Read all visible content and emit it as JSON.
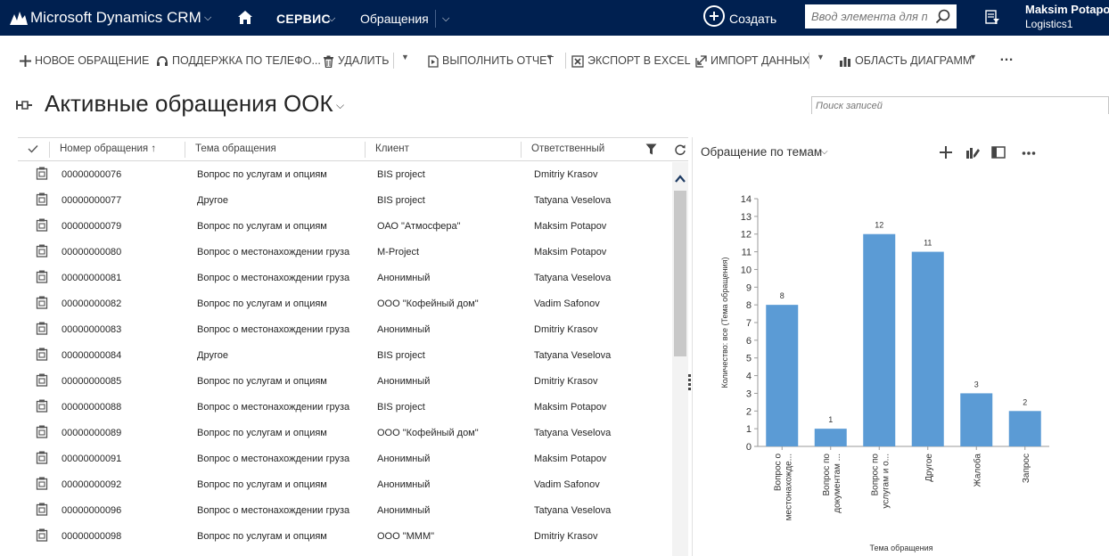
{
  "app": {
    "title": "Microsoft Dynamics CRM",
    "area": "СЕРВИС",
    "entity": "Обращения"
  },
  "create": {
    "label": "Создать"
  },
  "global_search": {
    "placeholder": "Ввод элемента для п"
  },
  "user": {
    "name": "Maksim Potapov",
    "org": "Logistics1"
  },
  "commands": [
    {
      "label": "НОВОЕ ОБРАЩЕНИЕ",
      "icon": "plus-icon"
    },
    {
      "label": "ПОДДЕРЖКА ПО ТЕЛЕФО...",
      "icon": "phone-support-icon"
    },
    {
      "label": "УДАЛИТЬ",
      "icon": "trash-icon"
    },
    {
      "label": "ВЫПОЛНИТЬ ОТЧЕТ",
      "icon": "report-icon"
    },
    {
      "label": "ЭКСПОРТ В EXCEL",
      "icon": "excel-icon"
    },
    {
      "label": "ИМПОРТ ДАННЫХ",
      "icon": "import-icon"
    },
    {
      "label": "ОБЛАСТЬ ДИАГРАММ",
      "icon": "chart-pane-icon"
    },
    {
      "label": "…",
      "icon": "more-icon"
    }
  ],
  "view": {
    "title": "Активные обращения ООК",
    "search_placeholder": "Поиск записей"
  },
  "grid": {
    "columns": [
      "Номер обращения",
      "Тема обращения",
      "Клиент",
      "Ответственный"
    ],
    "sort_indicator": "↑",
    "rows": [
      [
        "00000000076",
        "Вопрос по услугам и опциям",
        "BIS project",
        "Dmitriy Krasov"
      ],
      [
        "00000000077",
        "Другое",
        "BIS project",
        "Tatyana Veselova"
      ],
      [
        "00000000079",
        "Вопрос по услугам и опциям",
        "ОАО \"Атмосфера\"",
        "Maksim Potapov"
      ],
      [
        "00000000080",
        "Вопрос о местонахождении груза",
        "M-Project",
        "Maksim Potapov"
      ],
      [
        "00000000081",
        "Вопрос о местонахождении груза",
        "Анонимный",
        "Tatyana Veselova"
      ],
      [
        "00000000082",
        "Вопрос по услугам и опциям",
        "ООО \"Кофейный дом\"",
        "Vadim Safonov"
      ],
      [
        "00000000083",
        "Вопрос о местонахождении груза",
        "Анонимный",
        "Dmitriy Krasov"
      ],
      [
        "00000000084",
        "Другое",
        "BIS project",
        "Tatyana Veselova"
      ],
      [
        "00000000085",
        "Вопрос по услугам и опциям",
        "Анонимный",
        "Dmitriy Krasov"
      ],
      [
        "00000000088",
        "Вопрос о местонахождении груза",
        "BIS project",
        "Maksim Potapov"
      ],
      [
        "00000000089",
        "Вопрос по услугам и опциям",
        "ООО \"Кофейный дом\"",
        "Tatyana Veselova"
      ],
      [
        "00000000091",
        "Вопрос о местонахождении груза",
        "Анонимный",
        "Maksim Potapov"
      ],
      [
        "00000000092",
        "Вопрос по услугам и опциям",
        "Анонимный",
        "Vadim Safonov"
      ],
      [
        "00000000096",
        "Вопрос о местонахождении груза",
        "Анонимный",
        "Tatyana Veselova"
      ],
      [
        "00000000098",
        "Вопрос по услугам и опциям",
        "ООО \"МММ\"",
        "Dmitriy Krasov"
      ]
    ]
  },
  "chart_panel": {
    "title": "Обращение по темам"
  },
  "chart_data": {
    "type": "bar",
    "categories": [
      [
        "Вопрос о",
        "местонахожде..."
      ],
      [
        "Вопрос по",
        "документам ..."
      ],
      [
        "Вопрос по",
        "услугам и о..."
      ],
      [
        "Другое"
      ],
      [
        "Жалоба"
      ],
      [
        "Запрос"
      ]
    ],
    "values": [
      8,
      1,
      12,
      11,
      3,
      2
    ],
    "xlabel": "Тема обращения",
    "ylabel": "Количество: все (Тема обращения)",
    "ylim": [
      0,
      14
    ],
    "yticks": [
      0,
      1,
      2,
      3,
      4,
      5,
      6,
      7,
      8,
      9,
      10,
      11,
      12,
      13,
      14
    ],
    "data_labels": true,
    "grid": false,
    "bar_color": "#5b9bd5"
  },
  "colors": {
    "navbar": "#002050",
    "bar": "#5b9bd5"
  }
}
